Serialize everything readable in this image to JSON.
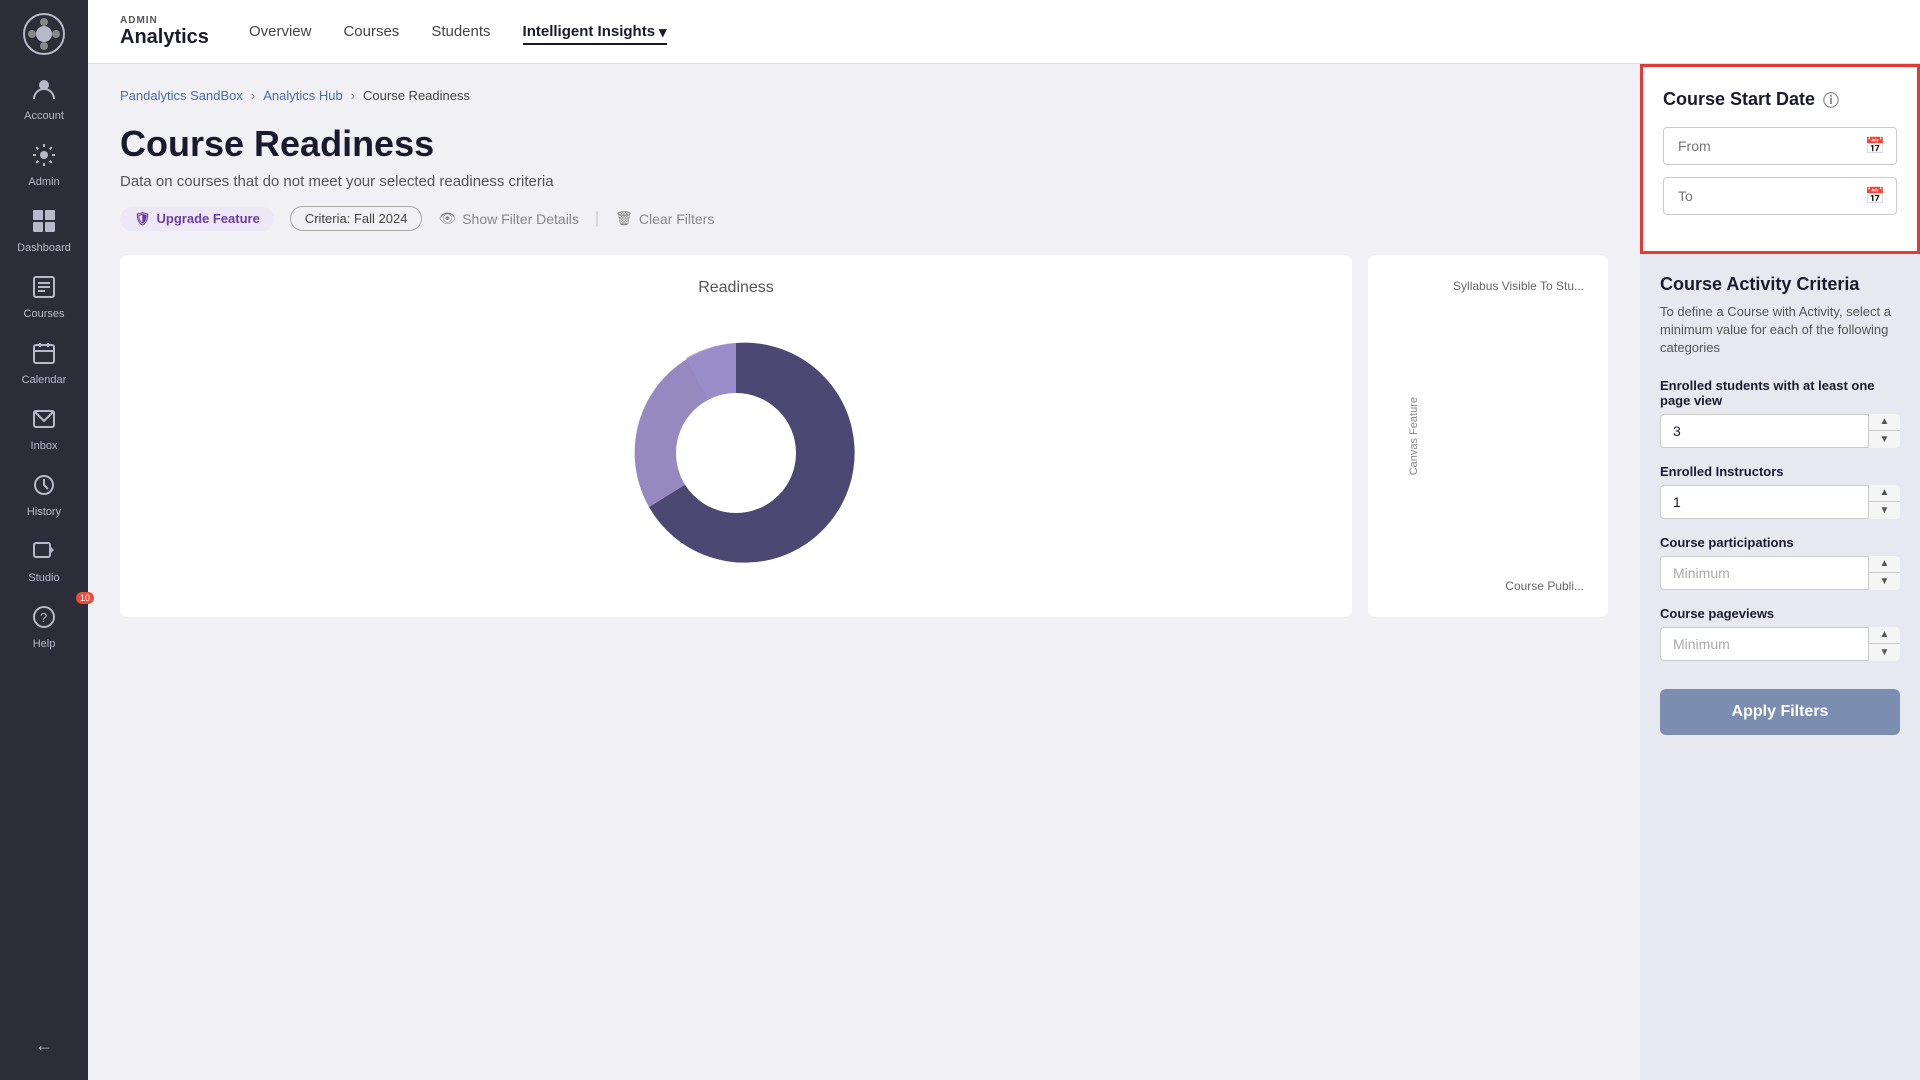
{
  "sidebar": {
    "logo_label": "●",
    "items": [
      {
        "id": "account",
        "icon": "👤",
        "label": "Account"
      },
      {
        "id": "admin",
        "icon": "⚙",
        "label": "Admin"
      },
      {
        "id": "dashboard",
        "icon": "⊞",
        "label": "Dashboard"
      },
      {
        "id": "courses",
        "icon": "📋",
        "label": "Courses"
      },
      {
        "id": "calendar",
        "icon": "📅",
        "label": "Calendar"
      },
      {
        "id": "inbox",
        "icon": "✉",
        "label": "Inbox"
      },
      {
        "id": "history",
        "icon": "🕐",
        "label": "History"
      },
      {
        "id": "studio",
        "icon": "🎬",
        "label": "Studio"
      },
      {
        "id": "help",
        "icon": "❓",
        "label": "Help",
        "badge": "10"
      }
    ],
    "collapse_icon": "←"
  },
  "topnav": {
    "brand_admin": "ADMIN",
    "brand_name": "Analytics",
    "links": [
      {
        "id": "overview",
        "label": "Overview",
        "active": false
      },
      {
        "id": "courses",
        "label": "Courses",
        "active": false
      },
      {
        "id": "students",
        "label": "Students",
        "active": false
      },
      {
        "id": "intelligent-insights",
        "label": "Intelligent Insights",
        "active": true,
        "has_arrow": true
      }
    ]
  },
  "breadcrumb": {
    "items": [
      {
        "label": "Pandalytics SandBox",
        "link": true
      },
      {
        "label": "Analytics Hub",
        "link": true
      },
      {
        "label": "Course Readiness",
        "link": false
      }
    ]
  },
  "page": {
    "title": "Course Readiness",
    "subtitle": "Data on courses that do not meet your selected readiness criteria",
    "upgrade_badge": "Upgrade Feature",
    "criteria_badge": "Criteria: Fall 2024",
    "show_filter": "Show Filter Details",
    "clear_filter": "Clear Filters"
  },
  "readiness_chart": {
    "title": "Readiness"
  },
  "partial_chart": {
    "feature_label": "Canvas Feature",
    "label1": "Syllabus Visible To Stu...",
    "label2": "Course Publi..."
  },
  "filter_panel": {
    "date_section": {
      "title": "Course Start Date",
      "from_placeholder": "From",
      "to_placeholder": "To"
    },
    "criteria_section": {
      "title": "Course Activity Criteria",
      "description": "To define a Course with Activity, select a minimum value for each of the following categories",
      "fields": [
        {
          "id": "enrolled-students",
          "label": "Enrolled students with at least one page view",
          "value": "3",
          "type": "spinner"
        },
        {
          "id": "enrolled-instructors",
          "label": "Enrolled Instructors",
          "value": "1",
          "type": "spinner"
        },
        {
          "id": "course-participations",
          "label": "Course participations",
          "placeholder": "Minimum",
          "type": "dropdown"
        },
        {
          "id": "course-pageviews",
          "label": "Course pageviews",
          "placeholder": "Minimum",
          "type": "dropdown"
        }
      ]
    },
    "apply_button": "Apply Filters"
  }
}
